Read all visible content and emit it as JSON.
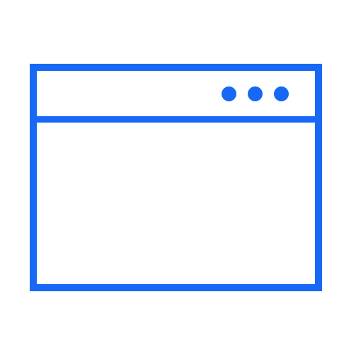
{
  "icon": {
    "name": "browser-window-icon",
    "accent_color": "#1768f5",
    "background_color": "#ffffff"
  },
  "title_bar": {
    "controls": [
      {
        "icon": "window-control-dot-icon"
      },
      {
        "icon": "window-control-dot-icon"
      },
      {
        "icon": "window-control-dot-icon"
      }
    ]
  }
}
